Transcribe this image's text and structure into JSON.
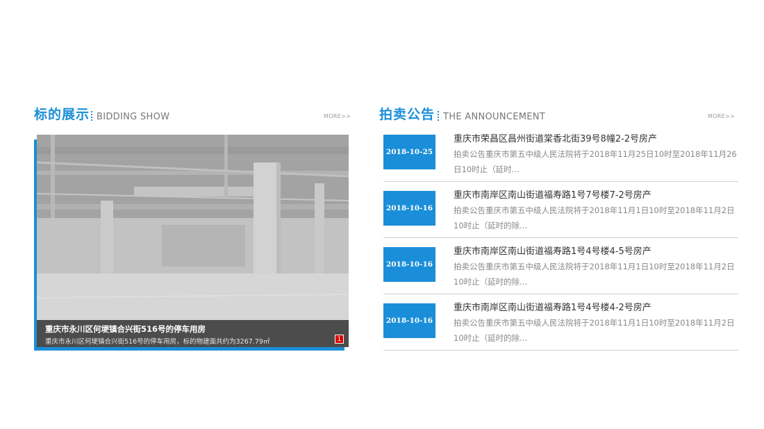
{
  "bidding": {
    "title_cn": "标的展示",
    "title_en": "BIDDING SHOW",
    "more_label": "MORE>>",
    "slide": {
      "title": "重庆市永川区何埂镇合兴街516号的停车用房",
      "description": "重庆市永川区何埂镇合兴街516号的停车用房，标的物建面共约为3267.79㎡",
      "page": "1"
    }
  },
  "announcement": {
    "title_cn": "拍卖公告",
    "title_en": "THE ANNOUNCEMENT",
    "more_label": "MORE>>",
    "items": [
      {
        "date": "2018-10-25",
        "title": "重庆市荣昌区昌州街道棠香北街39号8幢2-2号房产",
        "summary": "拍卖公告重庆市第五中级人民法院将于2018年11月25日10时至2018年11月26日10时止（延时..."
      },
      {
        "date": "2018-10-16",
        "title": "重庆市南岸区南山街道福寿路1号7号楼7-2号房产",
        "summary": "拍卖公告重庆市第五中级人民法院将于2018年11月1日10时至2018年11月2日10时止（延时的除..."
      },
      {
        "date": "2018-10-16",
        "title": "重庆市南岸区南山街道福寿路1号4号楼4-5号房产",
        "summary": "拍卖公告重庆市第五中级人民法院将于2018年11月1日10时至2018年11月2日10时止（延时的除..."
      },
      {
        "date": "2018-10-16",
        "title": "重庆市南岸区南山街道福寿路1号4号楼4-2号房产",
        "summary": "拍卖公告重庆市第五中级人民法院将于2018年11月1日10时至2018年11月2日10时止（延时的除..."
      }
    ]
  },
  "colors": {
    "accent": "#1a8ed8",
    "badge": "#d90000"
  }
}
